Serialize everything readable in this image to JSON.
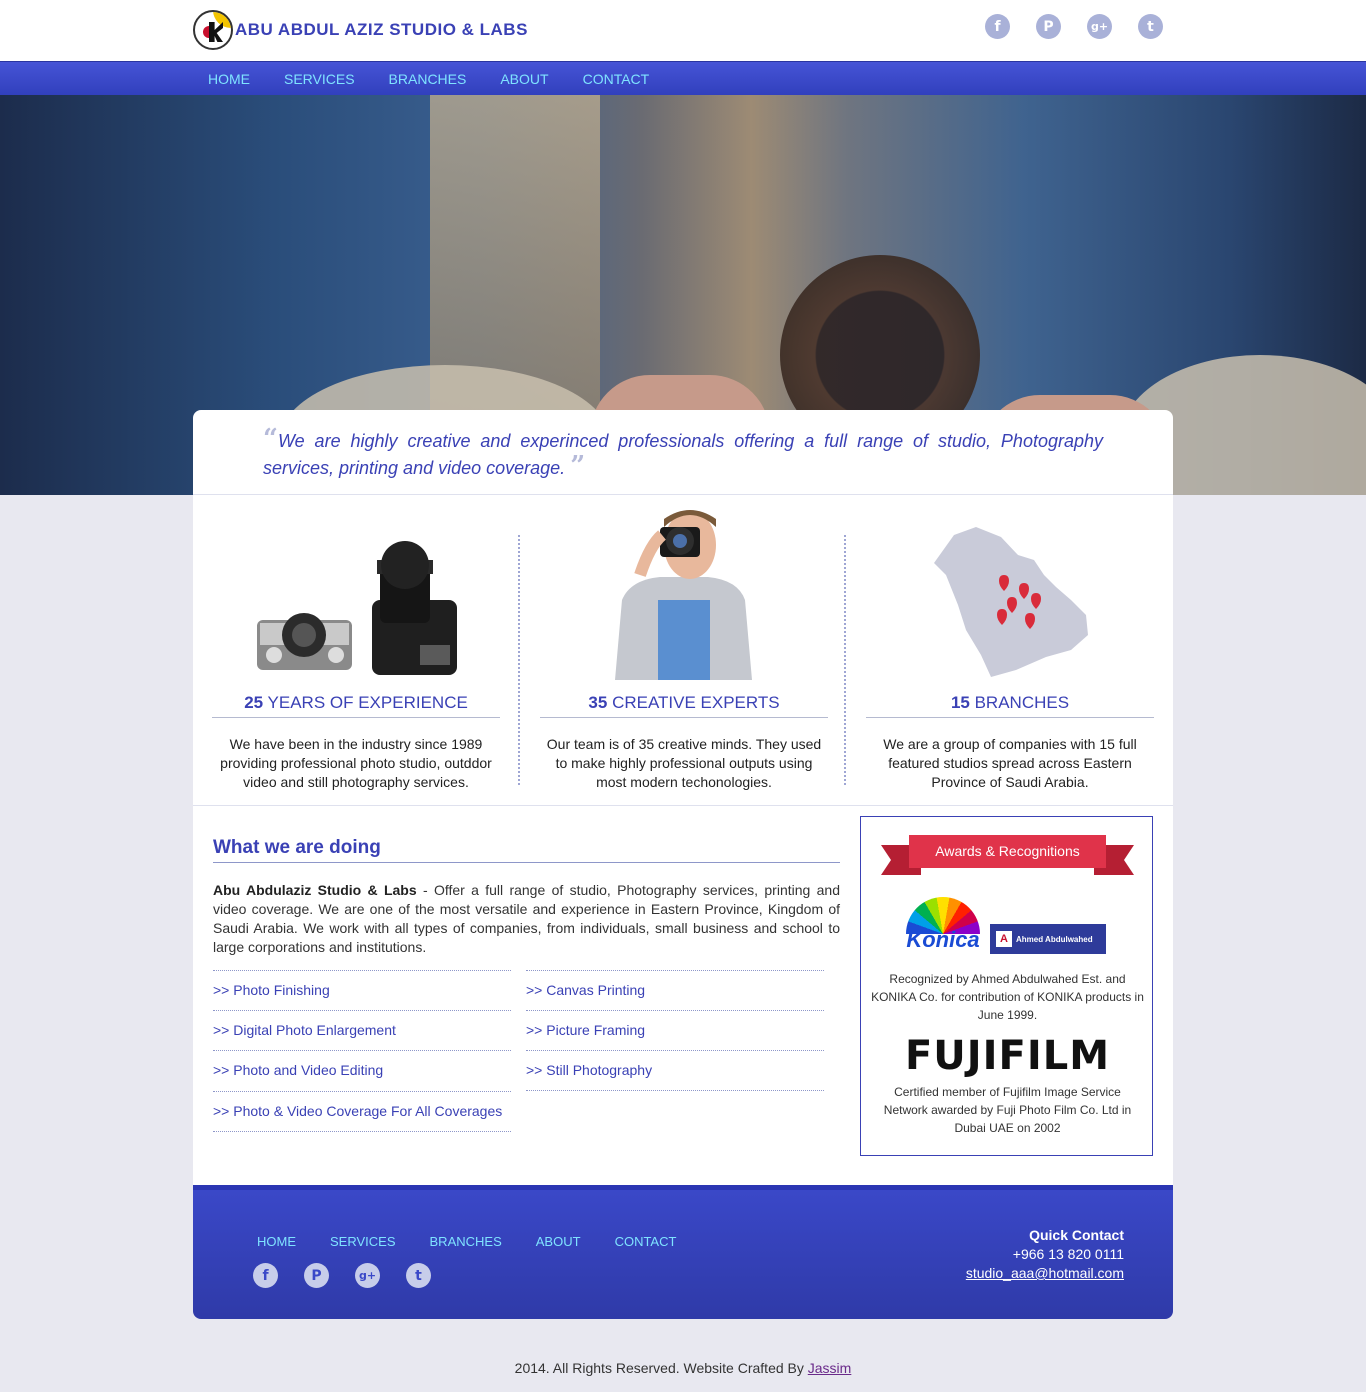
{
  "brand": {
    "name": "ABU ABDUL AZIZ STUDIO & LABS"
  },
  "social": [
    {
      "icon": "facebook-icon",
      "glyph": "f"
    },
    {
      "icon": "pinterest-icon",
      "glyph": "P"
    },
    {
      "icon": "google-plus-icon",
      "glyph": "g+"
    },
    {
      "icon": "twitter-icon",
      "glyph": "t"
    }
  ],
  "nav": [
    "HOME",
    "SERVICES",
    "BRANCHES",
    "ABOUT",
    "CONTACT"
  ],
  "quote": "We are highly creative and experinced professionals offering a full range of studio, Photography services, printing and video coverage.",
  "features": [
    {
      "number": "25",
      "title": "YEARS OF EXPERIENCE",
      "text": "We have been in the industry since 1989 providing professional photo studio, outddor video and still photography services."
    },
    {
      "number": "35",
      "title": "CREATIVE EXPERTS",
      "text": "Our team is of 35 creative minds. They used to make highly professional outputs using most modern techonologies."
    },
    {
      "number": "15",
      "title": "BRANCHES",
      "text": "We are a group of companies with 15 full featured studios spread across Eastern Province of Saudi Arabia."
    }
  ],
  "about": {
    "heading": "What we are doing",
    "company": "Abu Abdulaziz Studio & Labs",
    "text": " - Offer a full range of studio, Photography services, printing and video coverage. We are one of the most versatile and experience in Eastern Province, Kingdom of Saudi Arabia. We work with all types of companies, from individuals, small business and school to large corporations and institutions.",
    "services_left": [
      ">> Photo Finishing",
      ">> Digital Photo Enlargement",
      ">> Photo and Video Editing",
      ">> Photo & Video Coverage For All Coverages"
    ],
    "services_right": [
      ">> Canvas Printing",
      ">> Picture Framing",
      ">> Still Photography"
    ]
  },
  "awards": {
    "title": "Awards & Recognitions",
    "konica_logo": "Konica",
    "ahmed_logo": "Ahmed Abdulwahed",
    "konica_text": "Recognized by Ahmed Abdulwahed Est. and KONIKA Co. for contribution of KONIKA products in June 1999.",
    "fuji_logo": "FUJIFILM",
    "fuji_text": "Certified member of Fujifilm Image Service Network awarded by Fuji Photo Film Co. Ltd in Dubai UAE on 2002"
  },
  "footer": {
    "quick_contact": "Quick Contact",
    "phone": "+966 13 820 0111",
    "email": "studio_aaa@hotmail.com",
    "copyright": "2014. All Rights Reserved. Website Crafted By ",
    "author": "Jassim"
  }
}
